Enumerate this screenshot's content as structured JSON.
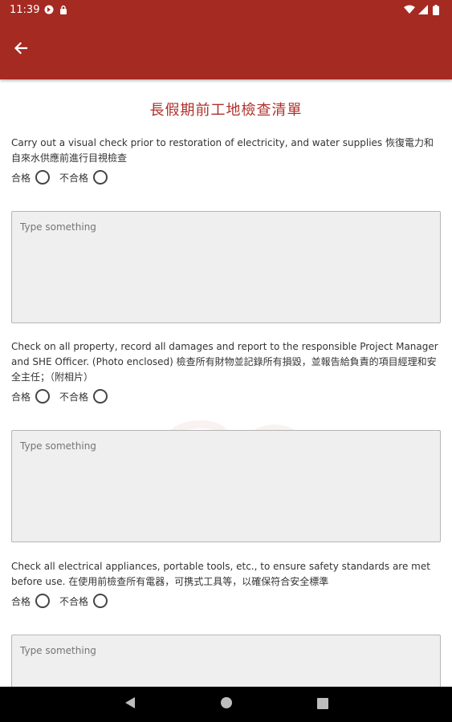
{
  "status_bar": {
    "time": "11:39"
  },
  "header": {
    "back_icon": "arrow-left-icon",
    "color": "#a52a22"
  },
  "page": {
    "title": "長假期前工地檢查清單",
    "title_color": "#b0302a"
  },
  "checklist": [
    {
      "question": "Carry out a visual check prior to restoration of electricity, and water supplies 恢復電力和自來水供應前進行目視檢查",
      "pass_label": "合格",
      "fail_label": "不合格",
      "remark_placeholder": "Type something"
    },
    {
      "question": "Check on all property, record all damages and report to the responsible Project Manager and SHE Officer. (Photo enclosed) 檢查所有財物並記錄所有損毀，並報告給負責的項目經理和安全主任；（附相片）",
      "pass_label": "合格",
      "fail_label": "不合格",
      "remark_placeholder": "Type something"
    },
    {
      "question": "Check all electrical appliances, portable tools, etc., to ensure safety standards are met before use. 在使用前檢查所有電器，可携式工具等，以確保符合安全標準",
      "pass_label": "合格",
      "fail_label": "不合格",
      "remark_placeholder": "Type something"
    }
  ],
  "nav_bar": {
    "back_icon": "nav-back-icon",
    "home_icon": "nav-home-icon",
    "recents_icon": "nav-recents-icon"
  }
}
